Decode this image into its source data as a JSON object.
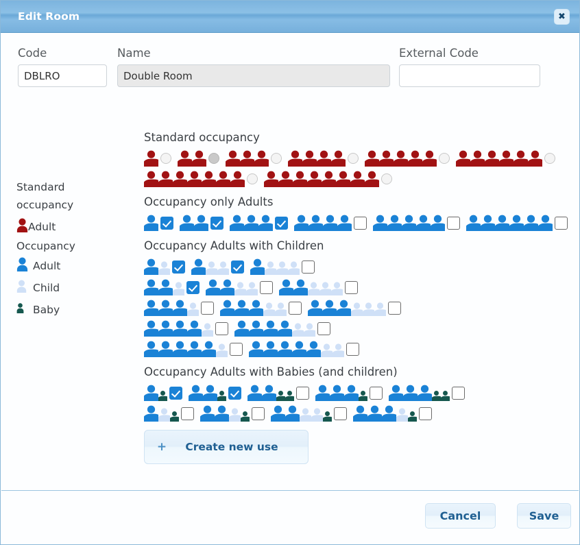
{
  "dialog": {
    "title": "Edit Room",
    "close_icon": "close-icon"
  },
  "form": {
    "code": {
      "label": "Code",
      "value": "DBLRO",
      "placeholder": ""
    },
    "name": {
      "label": "Name",
      "value": "Double Room",
      "placeholder": ""
    },
    "external_code": {
      "label": "External Code",
      "value": "",
      "placeholder": ""
    }
  },
  "legend": {
    "standard_title_line1": "Standard",
    "standard_title_line2": "occupancy",
    "standard_adult": "Adult",
    "occupancy_title": "Occupancy",
    "adult": "Adult",
    "child": "Child",
    "baby": "Baby"
  },
  "colors": {
    "adult_red": "#a11213",
    "adult_blue": "#1a82d6",
    "child_blue": "#cfe0f7",
    "baby_teal": "#16584f",
    "accent": "#7cb4de",
    "button_text": "#1f5f92"
  },
  "sections": {
    "standard": {
      "title": "Standard occupancy",
      "control": "radio",
      "rows": [
        [
          {
            "adults": 1,
            "children": 0,
            "babies": 0,
            "selected": false
          },
          {
            "adults": 2,
            "children": 0,
            "babies": 0,
            "selected": true
          },
          {
            "adults": 3,
            "children": 0,
            "babies": 0,
            "selected": false
          },
          {
            "adults": 4,
            "children": 0,
            "babies": 0,
            "selected": false
          },
          {
            "adults": 5,
            "children": 0,
            "babies": 0,
            "selected": false
          },
          {
            "adults": 6,
            "children": 0,
            "babies": 0,
            "selected": false
          }
        ],
        [
          {
            "adults": 7,
            "children": 0,
            "babies": 0,
            "selected": false
          },
          {
            "adults": 8,
            "children": 0,
            "babies": 0,
            "selected": false
          }
        ]
      ]
    },
    "adults_only": {
      "title": "Occupancy only Adults",
      "control": "checkbox",
      "rows": [
        [
          {
            "adults": 1,
            "children": 0,
            "babies": 0,
            "selected": true
          },
          {
            "adults": 2,
            "children": 0,
            "babies": 0,
            "selected": true
          },
          {
            "adults": 3,
            "children": 0,
            "babies": 0,
            "selected": true
          },
          {
            "adults": 4,
            "children": 0,
            "babies": 0,
            "selected": false
          },
          {
            "adults": 5,
            "children": 0,
            "babies": 0,
            "selected": false
          },
          {
            "adults": 6,
            "children": 0,
            "babies": 0,
            "selected": false
          }
        ]
      ]
    },
    "adults_children": {
      "title": "Occupancy Adults with Children",
      "control": "checkbox",
      "rows": [
        [
          {
            "adults": 1,
            "children": 1,
            "babies": 0,
            "selected": true
          },
          {
            "adults": 1,
            "children": 2,
            "babies": 0,
            "selected": true
          },
          {
            "adults": 1,
            "children": 3,
            "babies": 0,
            "selected": false
          }
        ],
        [
          {
            "adults": 2,
            "children": 1,
            "babies": 0,
            "selected": true
          },
          {
            "adults": 2,
            "children": 2,
            "babies": 0,
            "selected": false
          },
          {
            "adults": 2,
            "children": 3,
            "babies": 0,
            "selected": false
          }
        ],
        [
          {
            "adults": 3,
            "children": 1,
            "babies": 0,
            "selected": false
          },
          {
            "adults": 3,
            "children": 2,
            "babies": 0,
            "selected": false
          },
          {
            "adults": 3,
            "children": 3,
            "babies": 0,
            "selected": false
          }
        ],
        [
          {
            "adults": 4,
            "children": 1,
            "babies": 0,
            "selected": false
          },
          {
            "adults": 4,
            "children": 2,
            "babies": 0,
            "selected": false
          }
        ],
        [
          {
            "adults": 5,
            "children": 1,
            "babies": 0,
            "selected": false
          },
          {
            "adults": 5,
            "children": 2,
            "babies": 0,
            "selected": false
          }
        ]
      ]
    },
    "adults_babies": {
      "title": "Occupancy Adults with Babies (and children)",
      "control": "checkbox",
      "rows": [
        [
          {
            "adults": 1,
            "children": 0,
            "babies": 1,
            "selected": true
          },
          {
            "adults": 2,
            "children": 0,
            "babies": 1,
            "selected": true
          },
          {
            "adults": 2,
            "children": 0,
            "babies": 2,
            "selected": false
          },
          {
            "adults": 3,
            "children": 0,
            "babies": 1,
            "selected": false
          },
          {
            "adults": 3,
            "children": 0,
            "babies": 2,
            "selected": false
          }
        ],
        [
          {
            "adults": 1,
            "children": 1,
            "babies": 1,
            "selected": false
          },
          {
            "adults": 2,
            "children": 1,
            "babies": 1,
            "selected": false
          },
          {
            "adults": 2,
            "children": 2,
            "babies": 1,
            "selected": false
          },
          {
            "adults": 3,
            "children": 1,
            "babies": 1,
            "selected": false
          }
        ]
      ]
    }
  },
  "create_button": {
    "label": "Create new use",
    "plus": "+"
  },
  "footer": {
    "cancel": "Cancel",
    "save": "Save"
  }
}
